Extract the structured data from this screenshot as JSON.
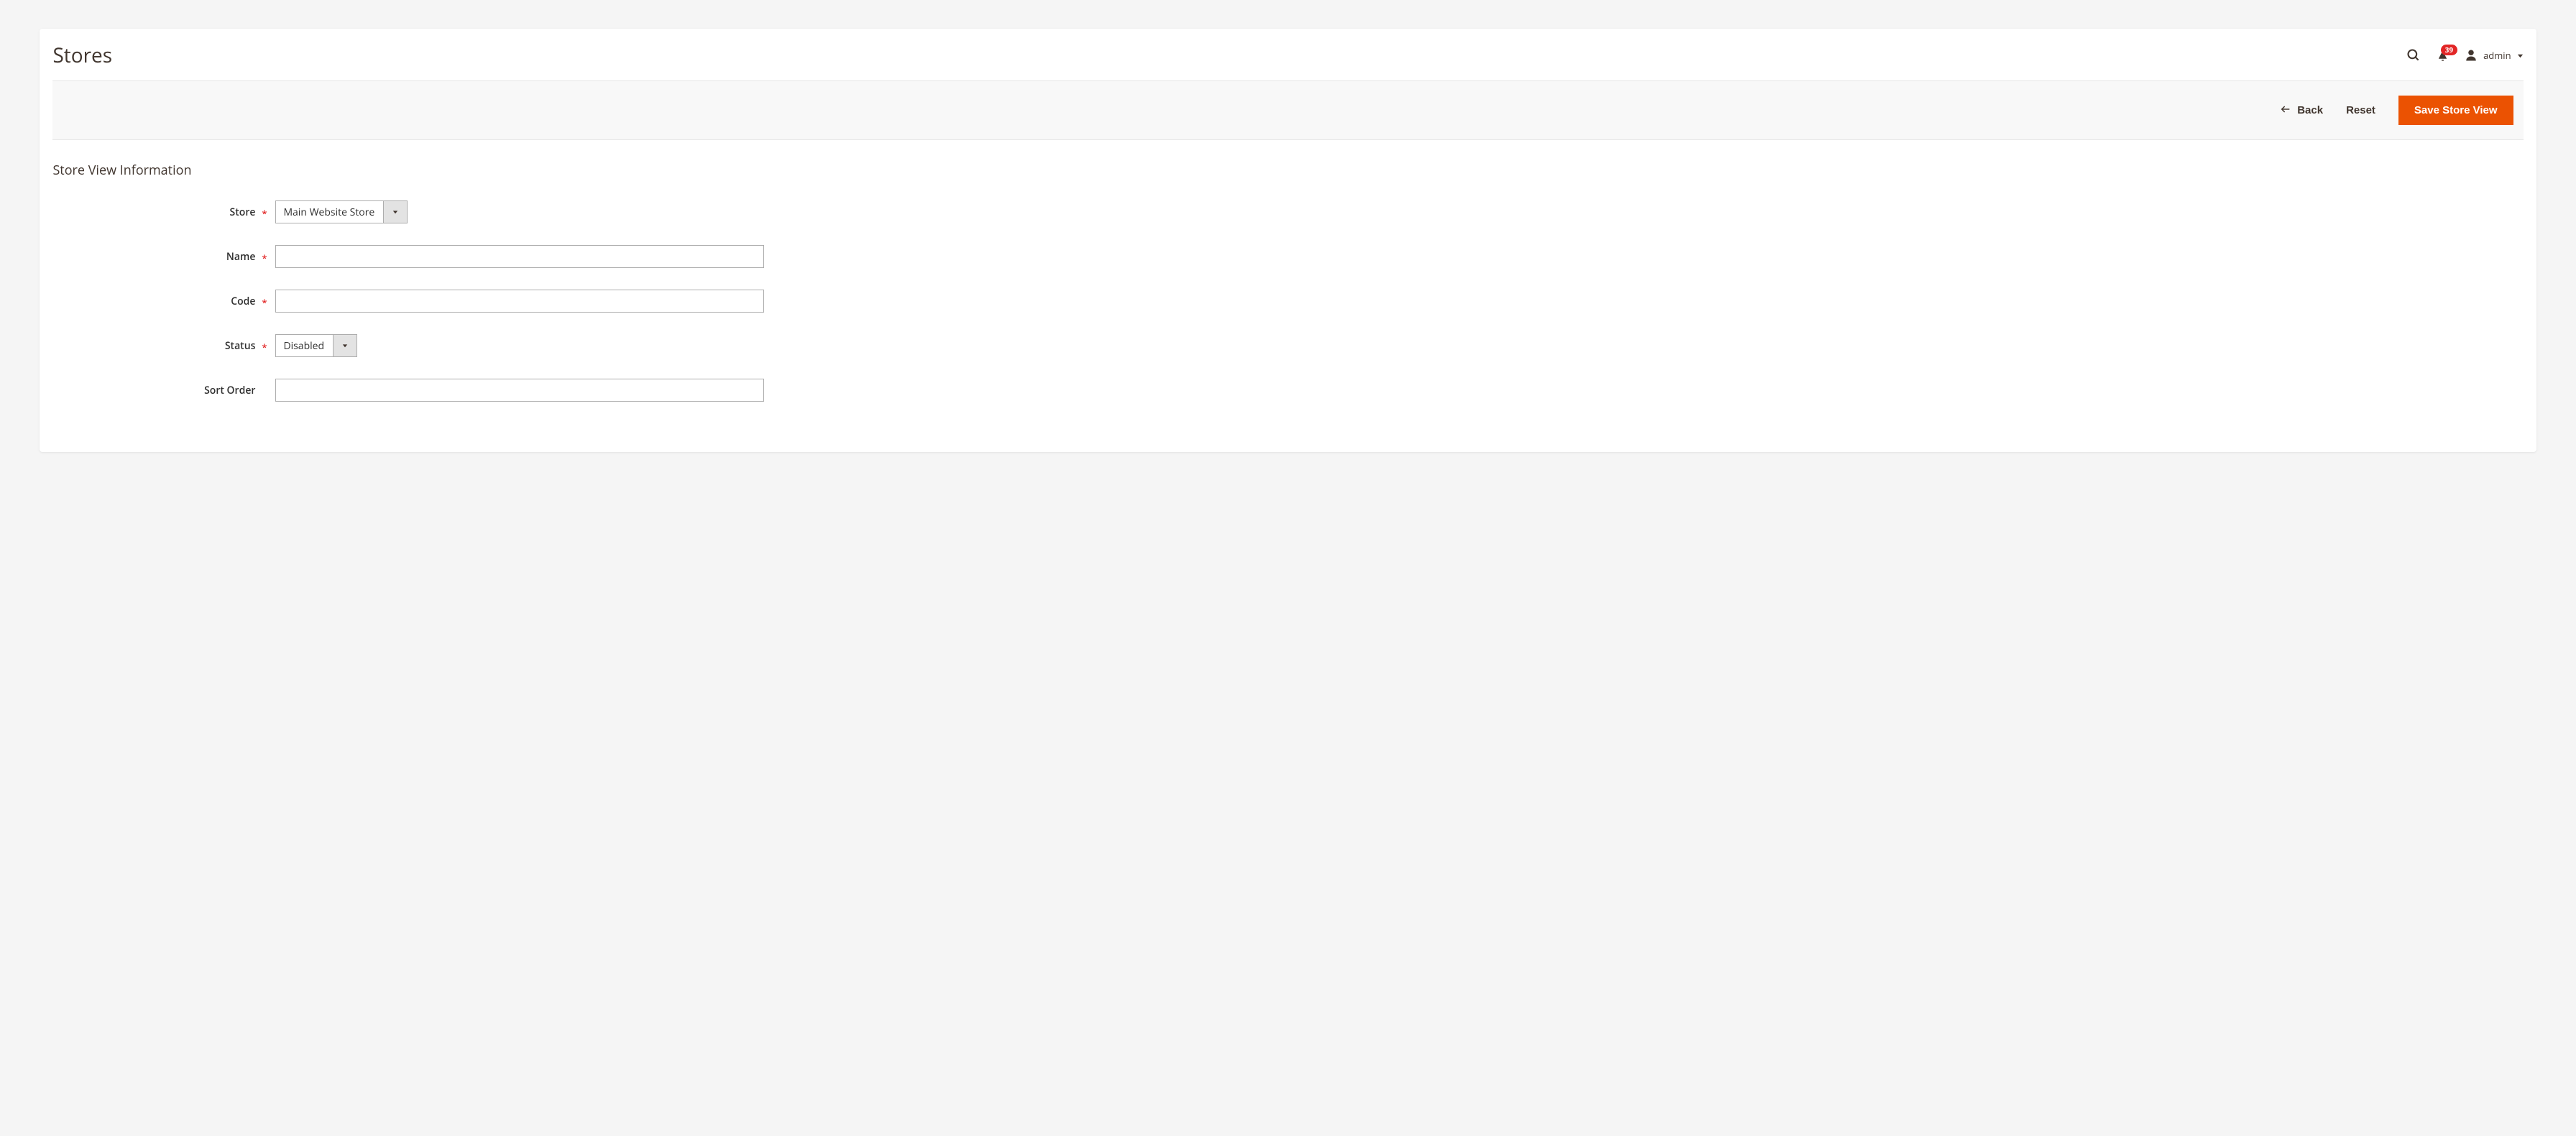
{
  "header": {
    "title": "Stores",
    "notif_count": "39",
    "username": "admin"
  },
  "actions": {
    "back": "Back",
    "reset": "Reset",
    "save": "Save Store View"
  },
  "section": {
    "title": "Store View Information"
  },
  "form": {
    "store_label": "Store",
    "store_value": "Main Website Store",
    "name_label": "Name",
    "name_value": "",
    "code_label": "Code",
    "code_value": "",
    "status_label": "Status",
    "status_value": "Disabled",
    "sort_order_label": "Sort Order",
    "sort_order_value": ""
  }
}
